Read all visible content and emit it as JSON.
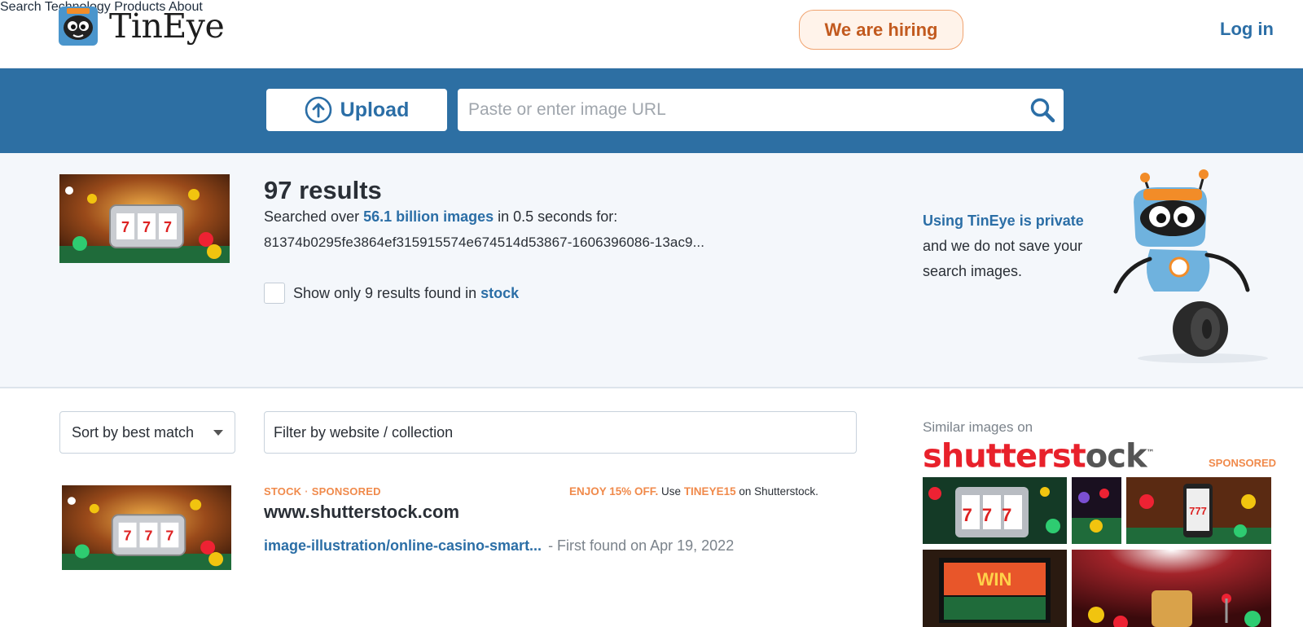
{
  "header": {
    "brand": "TinEye",
    "nav": [
      {
        "label": "Search"
      },
      {
        "label": "Technology"
      },
      {
        "label": "Products"
      },
      {
        "label": "About"
      }
    ],
    "hiring_label": "We are hiring",
    "login_label": "Log in"
  },
  "search": {
    "upload_label": "Upload",
    "url_placeholder": "Paste or enter image URL"
  },
  "summary": {
    "count_text": "97 results",
    "searched_prefix": "Searched over ",
    "searched_highlight": "56.1 billion images",
    "searched_suffix": " in 0.5 seconds for:",
    "query_hash": "81374b0295fe3864ef315915574e674514d53867-1606396086-13ac9...",
    "stock_prefix": "Show only 9 results found in ",
    "stock_link": "stock",
    "private_link": "Using TinEye is private",
    "private_text": "and we do not save your search images."
  },
  "filters": {
    "sort_label": "Sort by best match",
    "filter_placeholder": "Filter by website / collection"
  },
  "results": [
    {
      "tag_stock": "STOCK",
      "tag_separator": "·",
      "tag_sponsored": "SPONSORED",
      "promo_highlight": "ENJOY 15% OFF.",
      "promo_use": " Use ",
      "promo_code": "TINEYE15",
      "promo_suffix": " on Shutterstock.",
      "domain": "www.shutterstock.com",
      "link": "image-illustration/online-casino-smart...",
      "first_found": "- First found on Apr 19, 2022"
    }
  ],
  "sidebar": {
    "similar_label": "Similar images on",
    "brand_red": "shutterst",
    "brand_gray": "ck",
    "sponsored_label": "SPONSORED",
    "tiles": [
      {
        "label": "777"
      },
      {
        "label": ""
      },
      {
        "label": "777"
      },
      {
        "label": "WIN"
      },
      {
        "label": ""
      }
    ]
  },
  "colors": {
    "brand_blue": "#2d6fa3",
    "link_blue": "#2b6ea6",
    "accent_orange": "#f08a4b",
    "shutterstock_red": "#e8212b"
  }
}
